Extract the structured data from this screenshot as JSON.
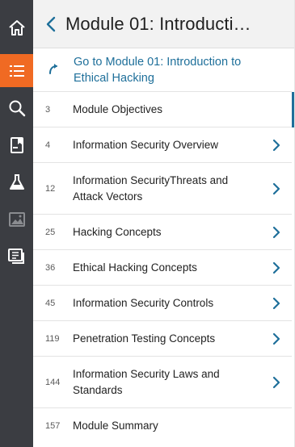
{
  "header": {
    "title": "Module 01: Introducti…"
  },
  "goto": {
    "label": "Go to Module 01: Introduction to Ethical Hacking"
  },
  "rail": {
    "icons": [
      "home-icon",
      "list-icon",
      "search-icon",
      "bookmark-icon",
      "lab-flask-icon",
      "image-icon",
      "notes-icon"
    ],
    "active": "list-icon"
  },
  "colors": {
    "rail_bg": "#3b3d42",
    "accent": "#f06a23",
    "link": "#1e6f9a"
  },
  "items": [
    {
      "page": "3",
      "label": "Module Objectives",
      "chevron": false,
      "current": true
    },
    {
      "page": "4",
      "label": "Information Security Overview",
      "chevron": true
    },
    {
      "page": "12",
      "label": "Information SecurityThreats and Attack Vectors",
      "chevron": true
    },
    {
      "page": "25",
      "label": "Hacking Concepts",
      "chevron": true
    },
    {
      "page": "36",
      "label": "Ethical Hacking Concepts",
      "chevron": true
    },
    {
      "page": "45",
      "label": "Information Security Controls",
      "chevron": true
    },
    {
      "page": "119",
      "label": "Penetration Testing Concepts",
      "chevron": true
    },
    {
      "page": "144",
      "label": "Information Security Laws and Standards",
      "chevron": true
    },
    {
      "page": "157",
      "label": "Module Summary",
      "chevron": false
    }
  ]
}
